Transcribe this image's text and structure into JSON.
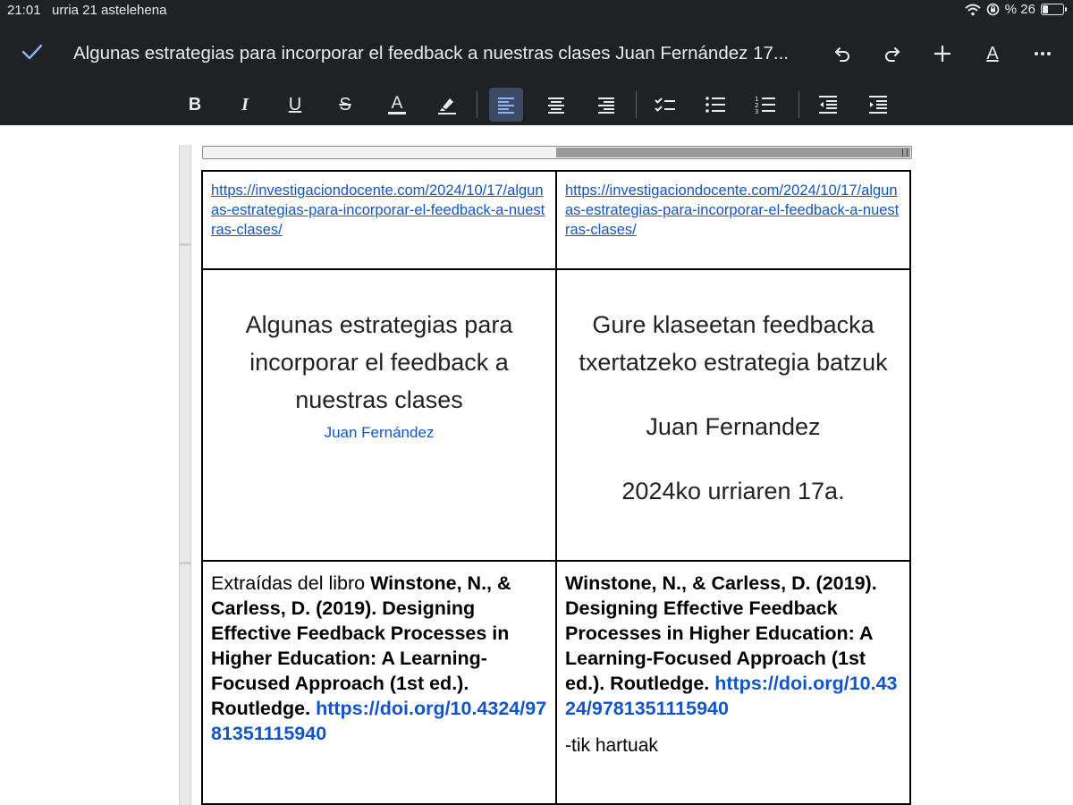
{
  "status_bar": {
    "time": "21:01",
    "date": "urria 21 astelehena",
    "battery_text": "% 26"
  },
  "header": {
    "title": "Algunas estrategias para incorporar el feedback a nuestras clases Juan Fernández 17...",
    "text_color_label": "A"
  },
  "toolbar": {
    "bold": "B",
    "italic": "I",
    "underline": "U",
    "strike": "S",
    "text_color": "A"
  },
  "table": {
    "row1": {
      "left_link": "https://investigaciondocente.com/2024/10/17/algunas-estrategias-para-incorporar-el-feedback-a-nuestras-clases/",
      "right_link": "https://investigaciondocente.com/2024/10/17/algunas-estrategias-para-incorporar-el-feedback-a-nuestras-clases/"
    },
    "row2": {
      "left_title": "Algunas estrategias para incorporar el feedback a nuestras clases",
      "left_author": "Juan Fernández",
      "right_title": "Gure klaseetan feedbacka txertatzeko estrategia batzuk",
      "right_author": "Juan Fernandez",
      "right_date": "2024ko urriaren 17a."
    },
    "row3": {
      "left_intro": "Extraídas del libro ",
      "left_ref": "Winstone, N., & Carless, D. (2019). Designing Effective Feedback Processes in Higher Education: A Learning-Focused Approach (1st ed.). Routledge.",
      "left_doi": "https://doi.org/10.4324/9781351115940",
      "right_ref": "Winstone, N., & Carless, D. (2019). Designing Effective Feedback Processes in Higher Education: A Learning-Focused Approach (1st ed.). Routledge.",
      "right_doi": "https://doi.org/10.4324/9781351115940",
      "right_suffix": "-tik hartuak"
    }
  },
  "colors": {
    "toolbar_bg": "#202124",
    "link": "#1155cc",
    "active_button": "#3c4a63",
    "check": "#8ab4f8"
  }
}
